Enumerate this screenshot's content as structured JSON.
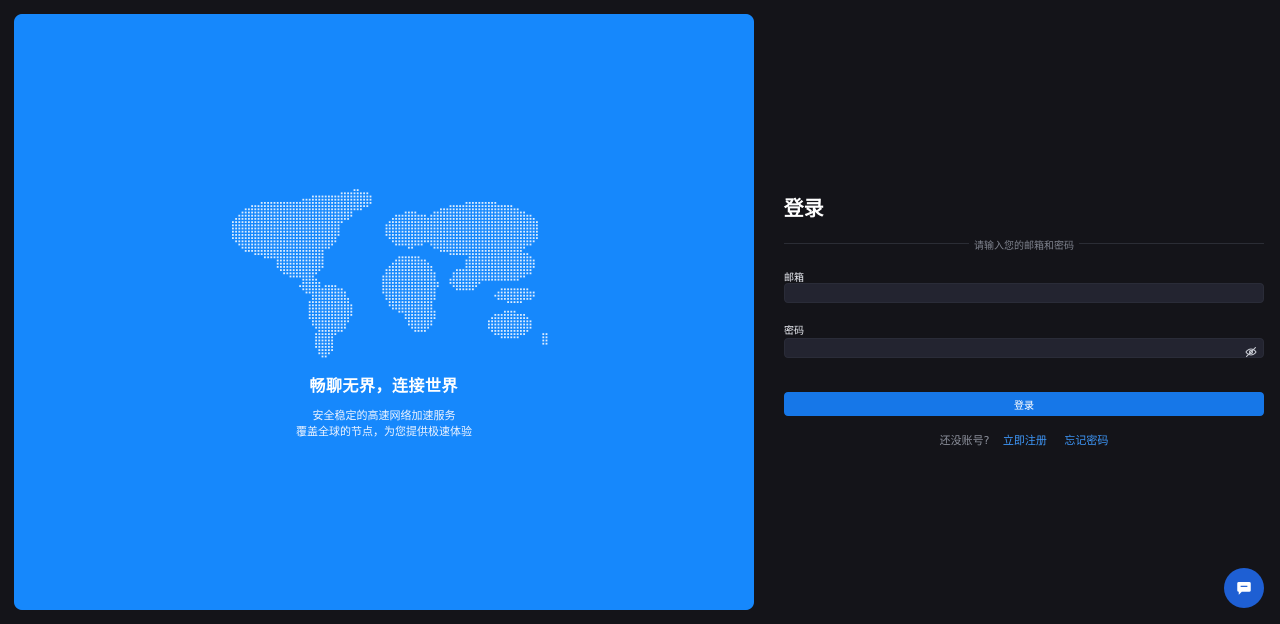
{
  "hero": {
    "title": "畅聊无界，连接世界",
    "subtitle_line1": "安全稳定的高速网络加速服务",
    "subtitle_line2": "覆盖全球的节点，为您提供极速体验",
    "background_color": "#1688fc",
    "illustration_icon": "world-dot-map"
  },
  "login": {
    "title": "登录",
    "divider_text": "请输入您的邮箱和密码",
    "email_label": "邮箱",
    "email_value": "",
    "password_label": "密码",
    "password_value": "",
    "password_toggle_icon": "eye-off-icon",
    "submit_label": "登录",
    "no_account_text": "还没账号?",
    "register_link": "立即注册",
    "forgot_link": "忘记密码",
    "accent_color": "#1677e8"
  },
  "chat": {
    "icon": "chat-bubble-icon"
  }
}
